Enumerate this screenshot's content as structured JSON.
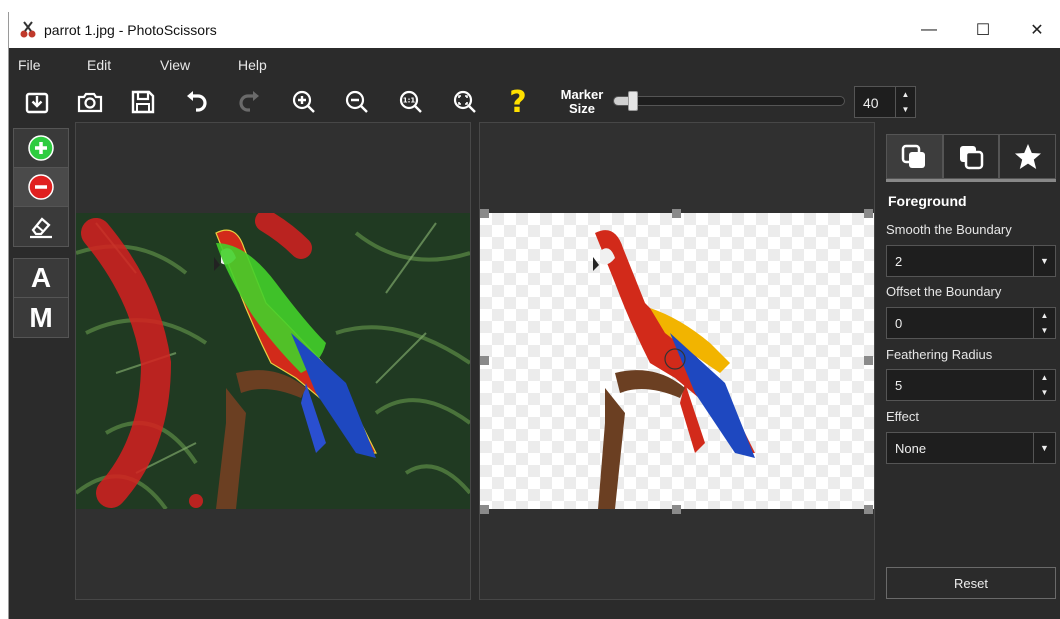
{
  "window": {
    "title": "parrot 1.jpg - PhotoScissors"
  },
  "window_controls": {
    "minimize": "—",
    "maximize": "☐",
    "close": "✕"
  },
  "menu": [
    "File",
    "Edit",
    "View",
    "Help"
  ],
  "toolbar": {
    "help_glyph": "?",
    "marker_size_label": "Marker Size",
    "marker_size_value": "40",
    "marker_size_fraction": 0.06,
    "spin_up": "▲",
    "spin_down": "▼"
  },
  "tools": {
    "auto_label": "A",
    "manual_label": "M"
  },
  "panel": {
    "heading": "Foreground",
    "smooth_label": "Smooth the Boundary",
    "smooth_value": "2",
    "offset_label": "Offset the Boundary",
    "offset_value": "0",
    "feather_label": "Feathering Radius",
    "feather_value": "5",
    "effect_label": "Effect",
    "effect_value": "None",
    "dropdown_glyph": "▼",
    "reset_label": "Reset"
  },
  "colors": {
    "accent_green": "#2ecc40",
    "remove_red": "#e02020",
    "help_yellow": "#ffe000",
    "background": "#2b2b2b"
  }
}
